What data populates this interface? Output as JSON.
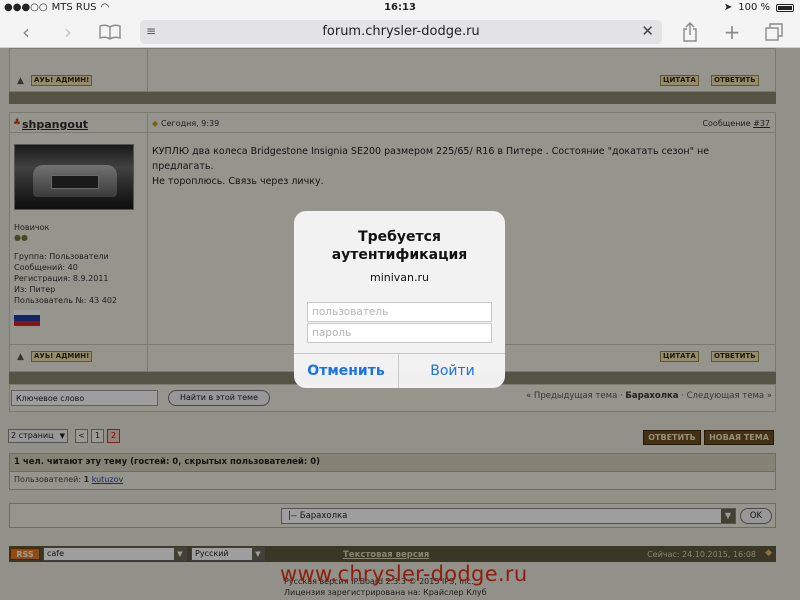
{
  "status_bar": {
    "carrier": "MTS RUS",
    "time": "16:13",
    "battery": "100 %"
  },
  "safari": {
    "url": "forum.chrysler-dodge.ru"
  },
  "forum": {
    "prev_post": {
      "btn_cfg": "АУЬ! АДМИН!",
      "btn_quote": "ЦИТАТА",
      "btn_reply": "ОТВЕТИТЬ"
    },
    "post": {
      "username": "shpangout",
      "date": "Сегодня, 9:39",
      "post_label": "Сообщение",
      "post_number": "#37",
      "body_line1": "КУПЛЮ два колеса Bridgestone Insignia SE200 размером 225/65/ R16 в Питере . Состояние \"докатать сезон\" не",
      "body_line2": "предлагать.",
      "body_line3": "Не тороплюсь. Связь через личку.",
      "rank": "Новичок",
      "group": "Группа: Пользователи",
      "messages": "Сообщений: 40",
      "registered": "Регистрация: 8.9.2011",
      "from": "Из: Питер",
      "user_number": "Пользователь №: 43 402",
      "btn_cfg": "АУЬ! АДМИН!",
      "btn_quote": "ЦИТАТА",
      "btn_reply": "ОТВЕТИТЬ"
    },
    "search": {
      "value": "Ключевое слово",
      "button": "Найти в этой теме"
    },
    "topic_nav": {
      "prev": "« Предыдущая тема",
      "sep1": "·",
      "forum": "Барахолка",
      "sep2": "·",
      "next": "Следующая тема »"
    },
    "pager": {
      "select": "2 страниц",
      "prev": "<",
      "page1": "1",
      "page2": "2",
      "reply_btn": "ОТВЕТИТЬ",
      "new_topic_btn": "НОВАЯ ТЕМА"
    },
    "readers": {
      "header": "1 чел. читают эту тему (гостей: 0, скрытых пользователей: 0)",
      "label": "Пользователей:",
      "count": "1",
      "user": "kutuzov"
    },
    "jump": {
      "value": "|-- Барахолка",
      "ok": "OK"
    },
    "footer": {
      "rss": "RSS",
      "skin": "cafe",
      "lang": "Русский",
      "text_version": "Текстовая версия",
      "now": "Сейчас: 24.10.2015, 16:08",
      "watermark": "www.chrysler-dodge.ru",
      "copyright": "Русская версия IP.Board 2.3.3 © 2015  IPS, Inc.",
      "license": "Лицензия зарегистрирована на: Крайслер Клуб"
    }
  },
  "auth_dialog": {
    "title_line1": "Требуется",
    "title_line2": "аутентификация",
    "host": "minivan.ru",
    "username_placeholder": "пользователь",
    "password_placeholder": "пароль",
    "cancel": "Отменить",
    "login": "Войти"
  }
}
